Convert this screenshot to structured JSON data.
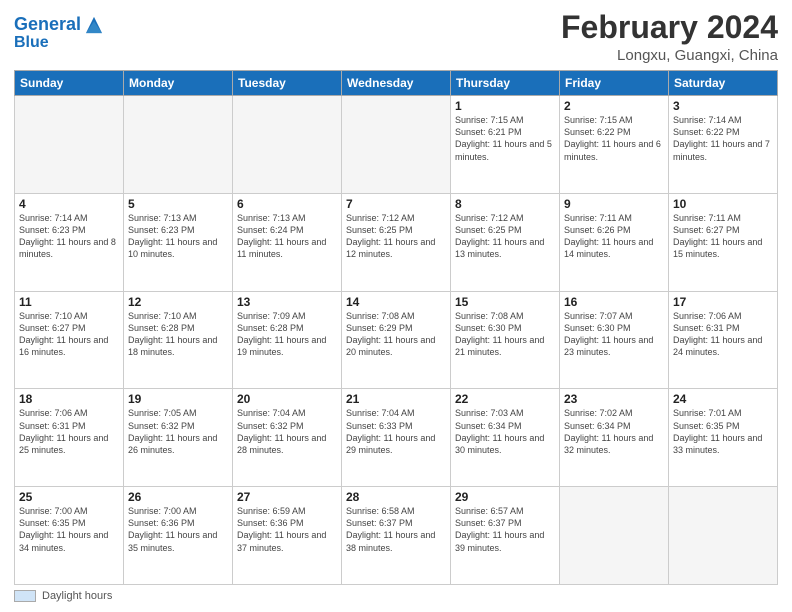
{
  "header": {
    "logo_line1": "General",
    "logo_line2": "Blue",
    "main_title": "February 2024",
    "sub_title": "Longxu, Guangxi, China"
  },
  "columns": [
    "Sunday",
    "Monday",
    "Tuesday",
    "Wednesday",
    "Thursday",
    "Friday",
    "Saturday"
  ],
  "weeks": [
    [
      {
        "day": "",
        "info": ""
      },
      {
        "day": "",
        "info": ""
      },
      {
        "day": "",
        "info": ""
      },
      {
        "day": "",
        "info": ""
      },
      {
        "day": "1",
        "info": "Sunrise: 7:15 AM\nSunset: 6:21 PM\nDaylight: 11 hours and 5 minutes."
      },
      {
        "day": "2",
        "info": "Sunrise: 7:15 AM\nSunset: 6:22 PM\nDaylight: 11 hours and 6 minutes."
      },
      {
        "day": "3",
        "info": "Sunrise: 7:14 AM\nSunset: 6:22 PM\nDaylight: 11 hours and 7 minutes."
      }
    ],
    [
      {
        "day": "4",
        "info": "Sunrise: 7:14 AM\nSunset: 6:23 PM\nDaylight: 11 hours and 8 minutes."
      },
      {
        "day": "5",
        "info": "Sunrise: 7:13 AM\nSunset: 6:23 PM\nDaylight: 11 hours and 10 minutes."
      },
      {
        "day": "6",
        "info": "Sunrise: 7:13 AM\nSunset: 6:24 PM\nDaylight: 11 hours and 11 minutes."
      },
      {
        "day": "7",
        "info": "Sunrise: 7:12 AM\nSunset: 6:25 PM\nDaylight: 11 hours and 12 minutes."
      },
      {
        "day": "8",
        "info": "Sunrise: 7:12 AM\nSunset: 6:25 PM\nDaylight: 11 hours and 13 minutes."
      },
      {
        "day": "9",
        "info": "Sunrise: 7:11 AM\nSunset: 6:26 PM\nDaylight: 11 hours and 14 minutes."
      },
      {
        "day": "10",
        "info": "Sunrise: 7:11 AM\nSunset: 6:27 PM\nDaylight: 11 hours and 15 minutes."
      }
    ],
    [
      {
        "day": "11",
        "info": "Sunrise: 7:10 AM\nSunset: 6:27 PM\nDaylight: 11 hours and 16 minutes."
      },
      {
        "day": "12",
        "info": "Sunrise: 7:10 AM\nSunset: 6:28 PM\nDaylight: 11 hours and 18 minutes."
      },
      {
        "day": "13",
        "info": "Sunrise: 7:09 AM\nSunset: 6:28 PM\nDaylight: 11 hours and 19 minutes."
      },
      {
        "day": "14",
        "info": "Sunrise: 7:08 AM\nSunset: 6:29 PM\nDaylight: 11 hours and 20 minutes."
      },
      {
        "day": "15",
        "info": "Sunrise: 7:08 AM\nSunset: 6:30 PM\nDaylight: 11 hours and 21 minutes."
      },
      {
        "day": "16",
        "info": "Sunrise: 7:07 AM\nSunset: 6:30 PM\nDaylight: 11 hours and 23 minutes."
      },
      {
        "day": "17",
        "info": "Sunrise: 7:06 AM\nSunset: 6:31 PM\nDaylight: 11 hours and 24 minutes."
      }
    ],
    [
      {
        "day": "18",
        "info": "Sunrise: 7:06 AM\nSunset: 6:31 PM\nDaylight: 11 hours and 25 minutes."
      },
      {
        "day": "19",
        "info": "Sunrise: 7:05 AM\nSunset: 6:32 PM\nDaylight: 11 hours and 26 minutes."
      },
      {
        "day": "20",
        "info": "Sunrise: 7:04 AM\nSunset: 6:32 PM\nDaylight: 11 hours and 28 minutes."
      },
      {
        "day": "21",
        "info": "Sunrise: 7:04 AM\nSunset: 6:33 PM\nDaylight: 11 hours and 29 minutes."
      },
      {
        "day": "22",
        "info": "Sunrise: 7:03 AM\nSunset: 6:34 PM\nDaylight: 11 hours and 30 minutes."
      },
      {
        "day": "23",
        "info": "Sunrise: 7:02 AM\nSunset: 6:34 PM\nDaylight: 11 hours and 32 minutes."
      },
      {
        "day": "24",
        "info": "Sunrise: 7:01 AM\nSunset: 6:35 PM\nDaylight: 11 hours and 33 minutes."
      }
    ],
    [
      {
        "day": "25",
        "info": "Sunrise: 7:00 AM\nSunset: 6:35 PM\nDaylight: 11 hours and 34 minutes."
      },
      {
        "day": "26",
        "info": "Sunrise: 7:00 AM\nSunset: 6:36 PM\nDaylight: 11 hours and 35 minutes."
      },
      {
        "day": "27",
        "info": "Sunrise: 6:59 AM\nSunset: 6:36 PM\nDaylight: 11 hours and 37 minutes."
      },
      {
        "day": "28",
        "info": "Sunrise: 6:58 AM\nSunset: 6:37 PM\nDaylight: 11 hours and 38 minutes."
      },
      {
        "day": "29",
        "info": "Sunrise: 6:57 AM\nSunset: 6:37 PM\nDaylight: 11 hours and 39 minutes."
      },
      {
        "day": "",
        "info": ""
      },
      {
        "day": "",
        "info": ""
      }
    ]
  ],
  "footer": {
    "swatch_label": "Daylight hours"
  }
}
